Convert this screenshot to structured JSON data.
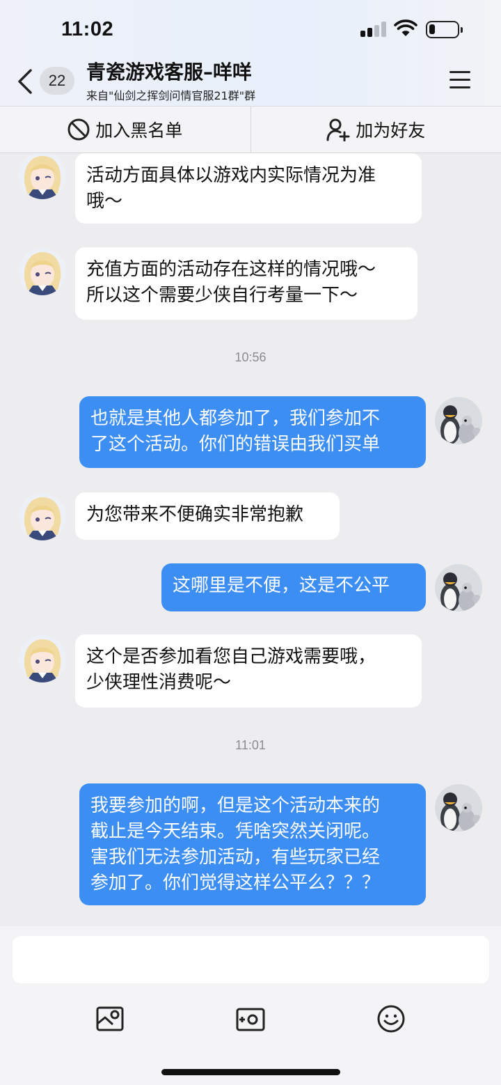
{
  "status_bar": {
    "time": "11:02",
    "battery_level": 0.2
  },
  "nav": {
    "unread_count": "22",
    "title": "青瓷游戏客服–咩咩",
    "subtitle": "来自\"仙剑之挥剑问情官服21群\"群"
  },
  "actions": {
    "block": "加入黑名单",
    "add_friend": "加为好友"
  },
  "messages": [
    {
      "side": "in",
      "text": "活动方面具体以游戏内实际情况为准\n哦～"
    },
    {
      "side": "in",
      "text": "充值方面的活动存在这样的情况哦～\n所以这个需要少侠自行考量一下～"
    },
    {
      "time": "10:56"
    },
    {
      "side": "out",
      "text": "也就是其他人都参加了，我们参加不\n了这个活动。你们的错误由我们买单"
    },
    {
      "side": "in",
      "text": "为您带来不便确实非常抱歉"
    },
    {
      "side": "out",
      "text": "这哪里是不便，这是不公平"
    },
    {
      "side": "in",
      "text": "这个是否参加看您自己游戏需要哦，\n少侠理性消费呢～"
    },
    {
      "time": "11:01"
    },
    {
      "side": "out",
      "text": "我要参加的啊，但是这个活动本来的\n截止是今天结束。凭啥突然关闭呢。\n害我们无法参加活动，有些玩家已经\n参加了。你们觉得这样公平么？？？"
    }
  ],
  "input": {
    "placeholder": ""
  },
  "icons": {
    "back": "chevron-left-icon",
    "menu": "hamburger-icon",
    "block": "no-entry-icon",
    "add_friend": "add-person-icon",
    "photo": "photo-icon",
    "camera": "camera-icon",
    "emoji": "emoji-icon"
  },
  "colors": {
    "outgoing_bubble": "#3d8ef3",
    "incoming_bubble": "#ffffff",
    "background": "#ededf0"
  }
}
